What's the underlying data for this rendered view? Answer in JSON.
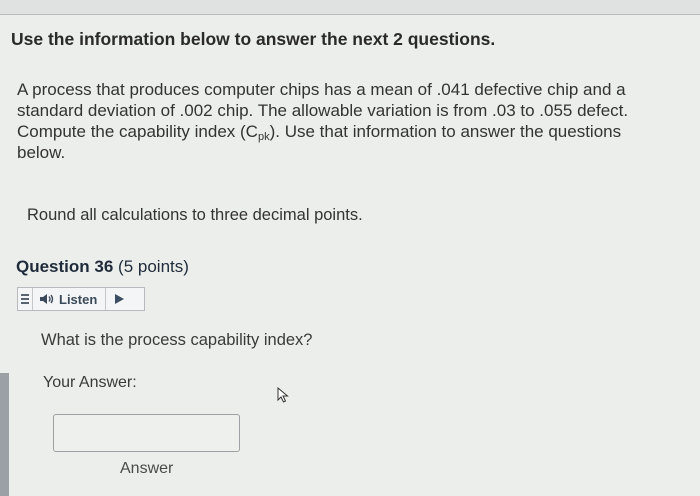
{
  "instructions": {
    "heading": "Use the information below to answer the next 2 questions.",
    "paragraph_lines": [
      "A process that produces computer chips has a mean of .041 defective chip and a",
      "standard deviation of .002 chip. The allowable variation is from .03 to .055 defect.",
      "Compute the capability index (C",
      "pk",
      "). Use that information to answer the questions",
      "below."
    ],
    "round_note": "Round all calculations to three decimal points."
  },
  "question": {
    "title": "Question 36",
    "points": "(5 points)",
    "listen_label": "Listen",
    "prompt": "What is the process capability index?",
    "your_answer_label": "Your Answer:",
    "answer_value": "",
    "answer_caption": "Answer"
  },
  "colors": {
    "background": "#eceeeb",
    "question_title": "#1f2b3a",
    "play_icon": "#3c4e63"
  }
}
